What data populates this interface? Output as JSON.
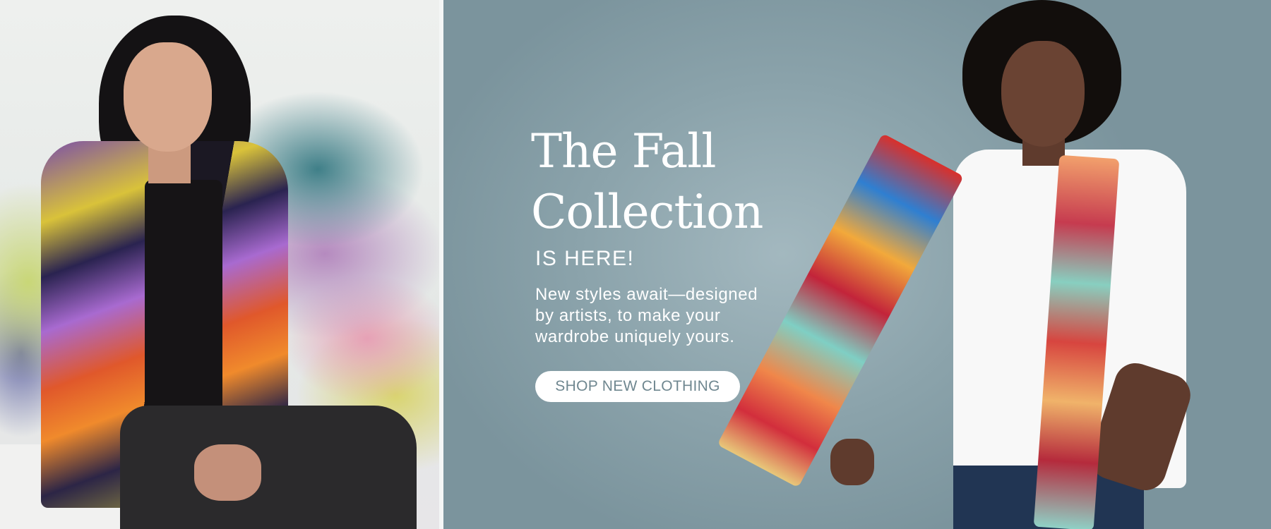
{
  "banner": {
    "headline_line1": "The Fall",
    "headline_line2": "Collection",
    "subhead": "IS HERE!",
    "body_line1": "New styles await—designed",
    "body_line2": "by artists, to make your",
    "body_line3": "wardrobe uniquely yours.",
    "cta_label": "SHOP NEW CLOTHING"
  },
  "colors": {
    "panel_teal": "#8ba3ab",
    "button_text": "#6f8790",
    "text": "#ffffff"
  }
}
